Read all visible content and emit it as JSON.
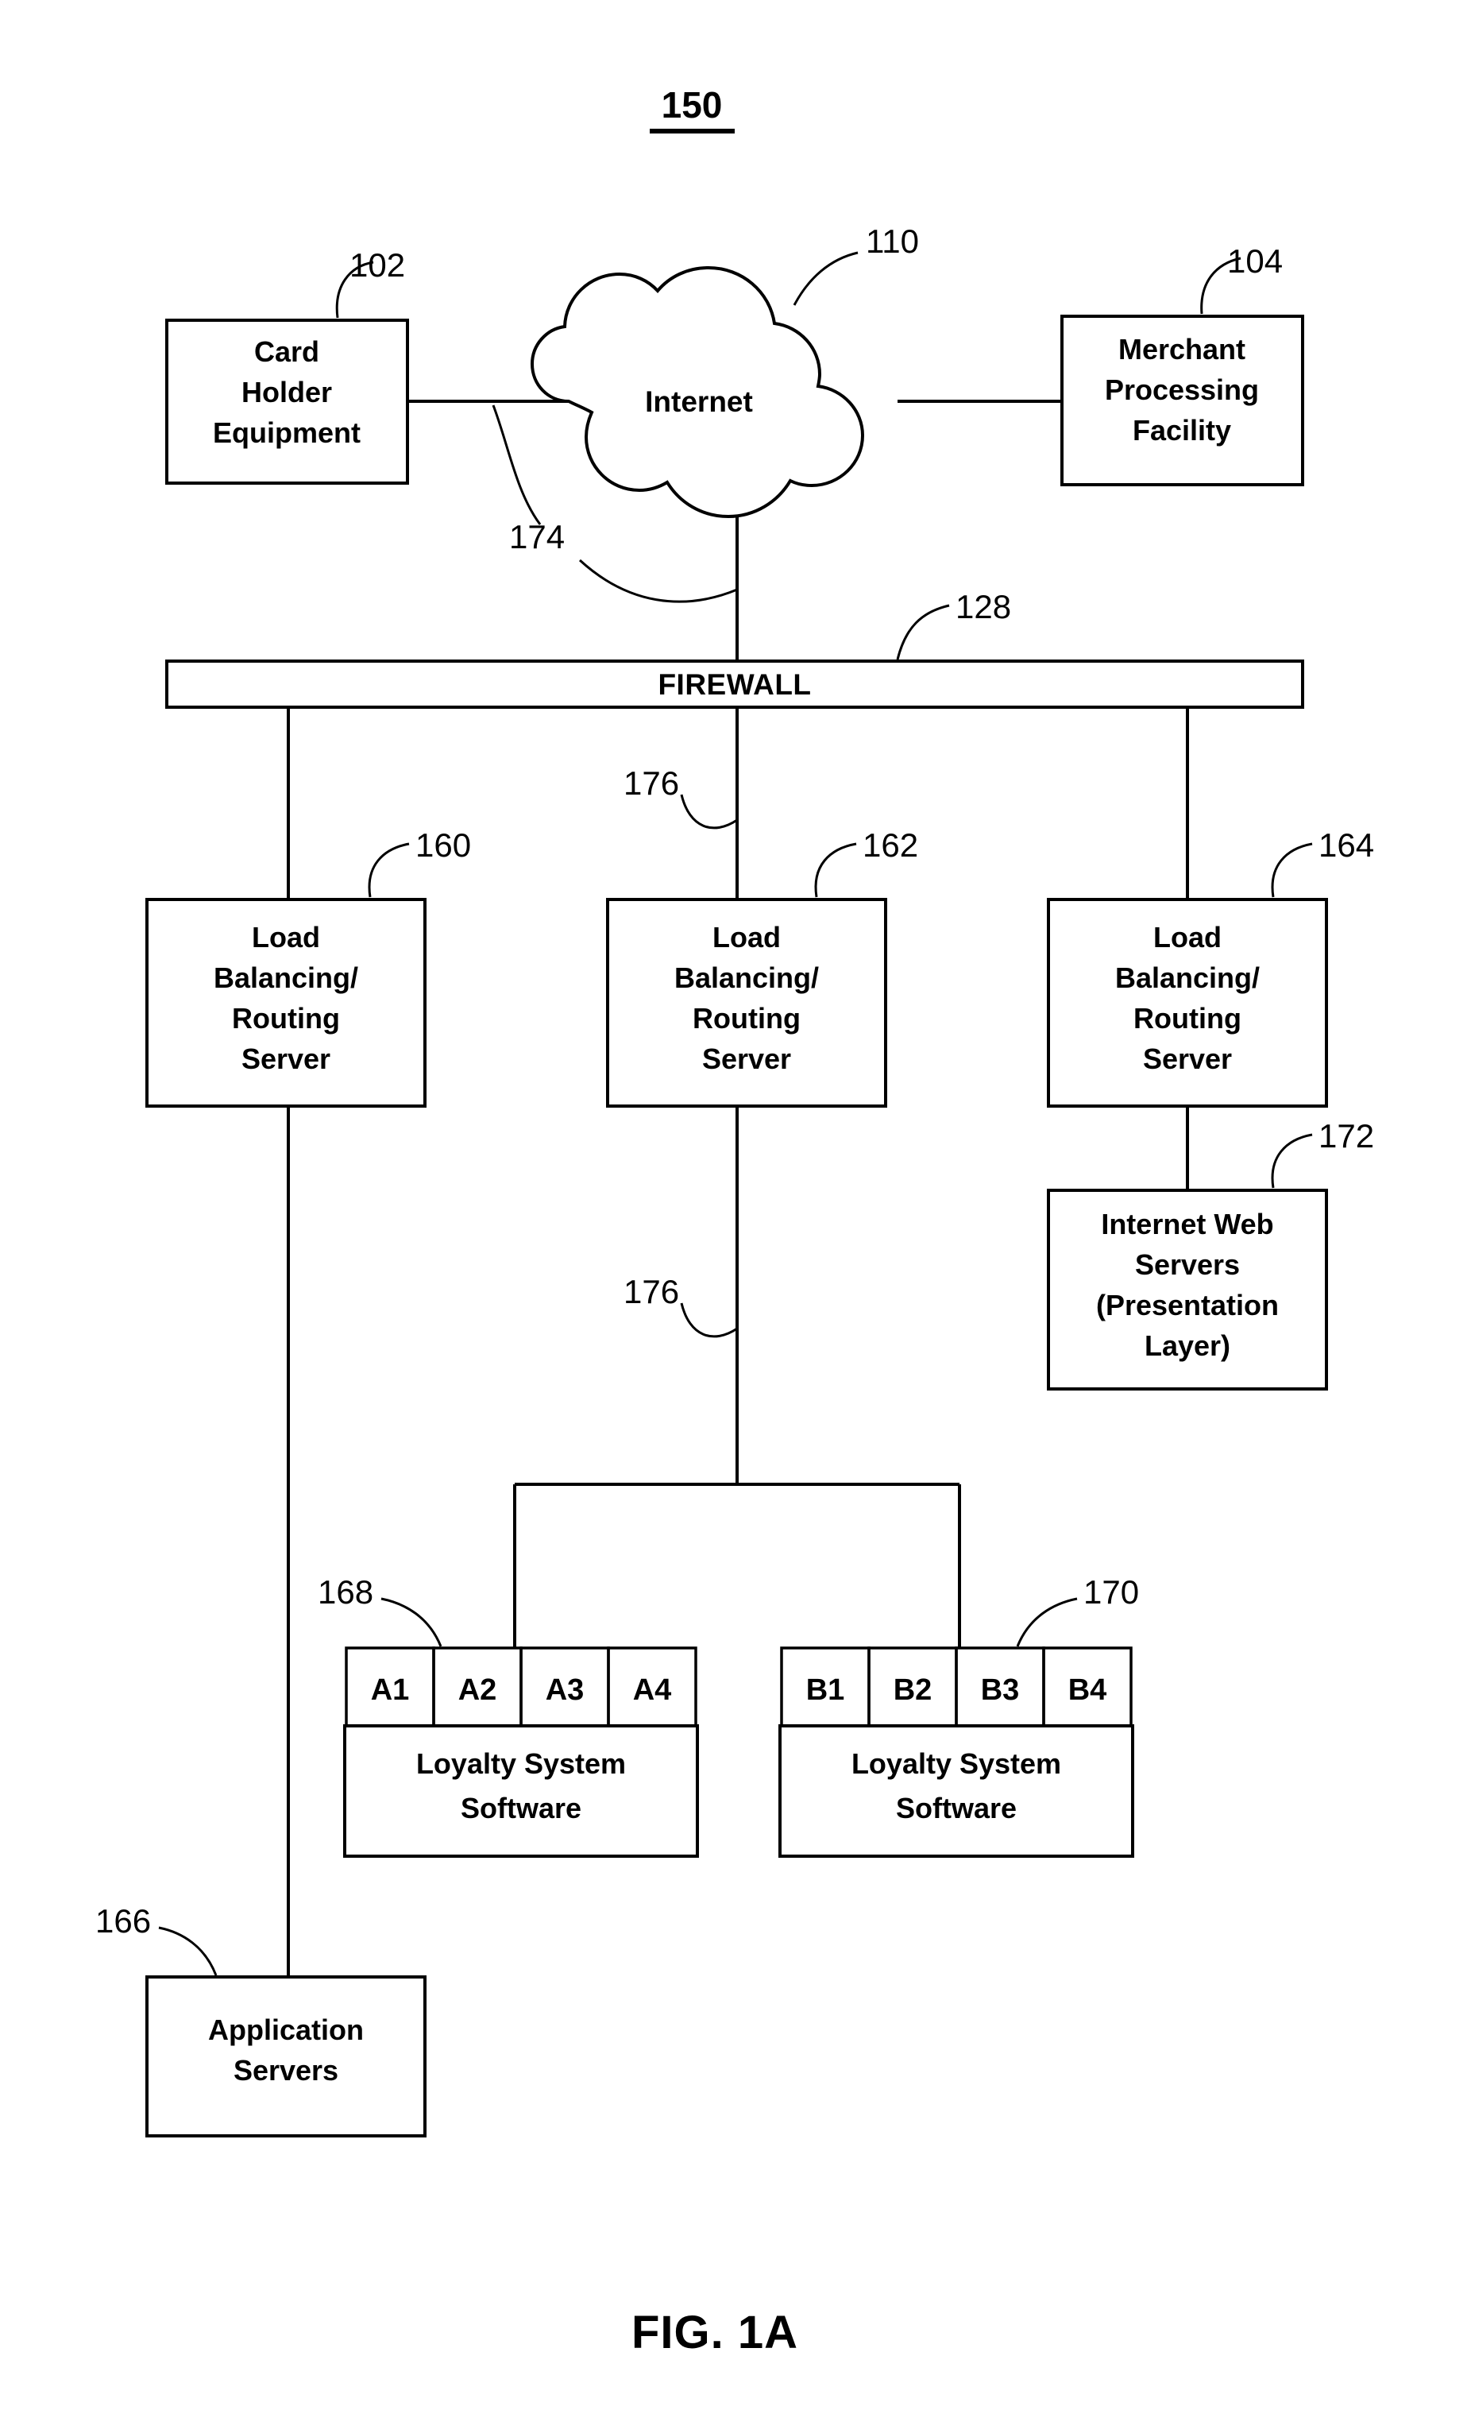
{
  "figure": {
    "top_number": "150",
    "caption": "FIG. 1A"
  },
  "nodes": {
    "card_holder": {
      "ref": "102",
      "lines": [
        "Card",
        "Holder",
        "Equipment"
      ]
    },
    "internet": {
      "ref": "110",
      "label": "Internet"
    },
    "merchant": {
      "ref": "104",
      "lines": [
        "Merchant",
        "Processing",
        "Facility"
      ]
    },
    "firewall": {
      "ref": "128",
      "label": "FIREWALL"
    },
    "lb_left": {
      "ref": "160",
      "lines": [
        "Load",
        "Balancing/",
        "Routing",
        "Server"
      ]
    },
    "lb_center": {
      "ref": "162",
      "lines": [
        "Load",
        "Balancing/",
        "Routing",
        "Server"
      ]
    },
    "lb_right": {
      "ref": "164",
      "lines": [
        "Load",
        "Balancing/",
        "Routing",
        "Server"
      ]
    },
    "web_servers": {
      "ref": "172",
      "lines": [
        "Internet Web",
        "Servers",
        "(Presentation",
        "Layer)"
      ]
    },
    "cluster_a": {
      "ref": "168",
      "cells": [
        "A1",
        "A2",
        "A3",
        "A4"
      ],
      "lines": [
        "Loyalty System",
        "Software"
      ]
    },
    "cluster_b": {
      "ref": "170",
      "cells": [
        "B1",
        "B2",
        "B3",
        "B4"
      ],
      "lines": [
        "Loyalty System",
        "Software"
      ]
    },
    "app_servers": {
      "ref": "166",
      "lines": [
        "Application",
        "Servers"
      ]
    }
  },
  "connection_refs": {
    "internet_link": "174",
    "network_link_upper": "176",
    "network_link_lower": "176"
  },
  "colors": {
    "ink": "#000000",
    "paper": "#ffffff"
  }
}
